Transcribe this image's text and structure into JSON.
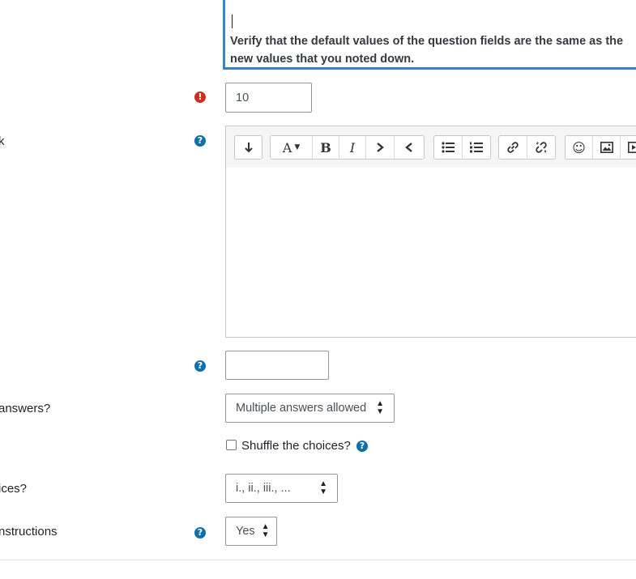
{
  "question_text": {
    "content": "Verify that the default values of the question fields are the same as the new values that you noted down."
  },
  "default_mark": {
    "value": "10"
  },
  "general_feedback": {
    "label_fragment": "k",
    "toolbar_icons": [
      "insert-line-icon",
      "font-color-icon",
      "bold-icon",
      "italic-icon",
      "indent-icon",
      "outdent-icon",
      "bullet-list-icon",
      "numbered-list-icon",
      "link-icon",
      "unlink-icon",
      "emoji-icon",
      "image-icon",
      "media-icon"
    ],
    "bold_label": "B",
    "italic_label": "I",
    "fontcolor_label": "A"
  },
  "id_number": {
    "value": ""
  },
  "single_answer": {
    "label_fragment": "answers?",
    "selected": "Multiple answers allowed"
  },
  "shuffle": {
    "label": "Shuffle the choices?"
  },
  "numbering": {
    "label_fragment": "ices?",
    "selected": "i., ii., iii., ..."
  },
  "show_instructions": {
    "label_fragment": "nstructions",
    "selected": "Yes"
  },
  "colors": {
    "accent": "#3584c6",
    "help": "#0f6fa7",
    "required": "#ca3120"
  }
}
